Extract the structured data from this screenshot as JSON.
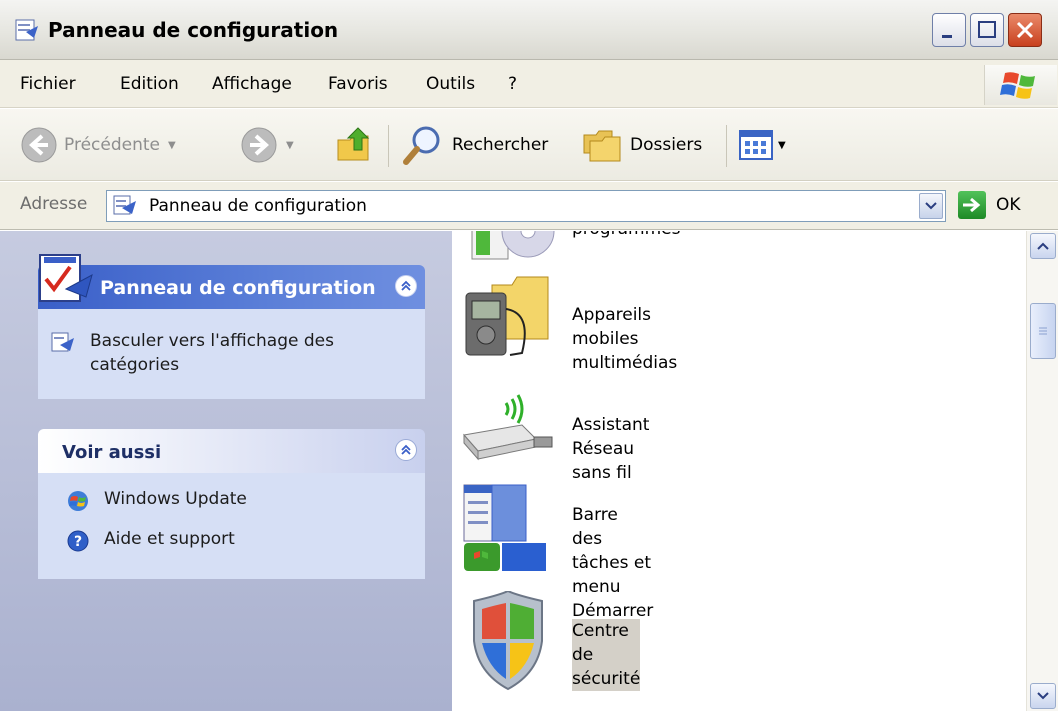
{
  "window": {
    "title": "Panneau de configuration"
  },
  "menu": {
    "items": [
      {
        "label": "Fichier"
      },
      {
        "label": "Edition"
      },
      {
        "label": "Affichage"
      },
      {
        "label": "Favoris"
      },
      {
        "label": "Outils"
      },
      {
        "label": "?"
      }
    ]
  },
  "toolbar": {
    "back_label": "Précédente",
    "search_label": "Rechercher",
    "folders_label": "Dossiers"
  },
  "address": {
    "label": "Adresse",
    "value": "Panneau de configuration",
    "go_label": "OK"
  },
  "left_pane": {
    "panel1": {
      "title": "Panneau de configuration",
      "link_line1": "Basculer vers l'affichage des",
      "link_line2": "catégories"
    },
    "panel2": {
      "title": "Voir aussi",
      "links": [
        "Windows Update",
        "Aide et support"
      ]
    }
  },
  "items": [
    {
      "label": "programmes"
    },
    {
      "label": "Appareils mobiles multimédias"
    },
    {
      "label": "Assistant Réseau sans fil"
    },
    {
      "label_line1": "Barre des tâches et menu",
      "label_line2": "Démarrer"
    },
    {
      "label": "Centre de sécurité",
      "selected": true
    }
  ],
  "colors": {
    "title_bar": "#e6e6e0",
    "task_pane_header": "#3a5fc8",
    "selection": "#d4d0c8"
  }
}
